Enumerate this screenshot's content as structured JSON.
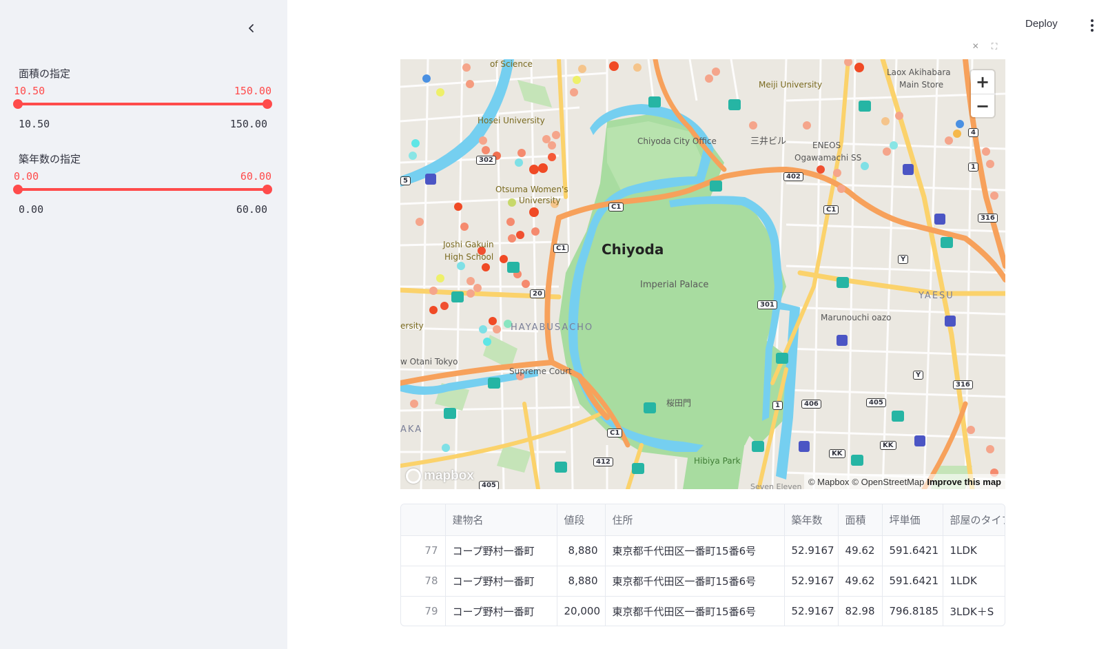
{
  "sidebar": {
    "sliders": [
      {
        "label": "面積の指定",
        "lo": "10.50",
        "hi": "150.00",
        "min": "10.50",
        "max": "150.00"
      },
      {
        "label": "築年数の指定",
        "lo": "0.00",
        "hi": "60.00",
        "min": "0.00",
        "max": "60.00"
      }
    ]
  },
  "header": {
    "deploy_label": "Deploy"
  },
  "map": {
    "labels": {
      "chiyoda": "Chiyoda",
      "imperial_palace": "Imperial Palace",
      "hosei": "Hosei University",
      "otsuma": "Otsuma Women's University",
      "otsuma_1": "Otsuma Women's",
      "otsuma_2": "University",
      "joshi_1": "Joshi Gakuin",
      "joshi_2": "High School",
      "meiji": "Meiji University",
      "laox_1": "Laox Akihabara",
      "laox_2": "Main Store",
      "chiyoda_office": "Chiyoda City Office",
      "mitsui": "三井ビル",
      "eneos_1": "ENEOS",
      "eneos_2": "Ogawamachi SS",
      "hayabusacho": "HAYABUSACHO",
      "supreme": "Supreme Court",
      "sakuradamon": "桜田門",
      "hibiya": "Hibiya Park",
      "marunouchi": "Marunouchi oazo",
      "yaesu": "YAESU",
      "otani": "w Otani Tokyo",
      "of_science": "of Science",
      "ersity": "ersity",
      "aka": "AKA",
      "seven_eleven": "Seven Eleven"
    },
    "routes": [
      "C1",
      "C1",
      "C1",
      "C1",
      "302",
      "402",
      "20",
      "301",
      "316",
      "316",
      "412",
      "406",
      "405",
      "4",
      "1",
      "1",
      "Y",
      "Y",
      "KK",
      "KK",
      "405",
      "5"
    ],
    "zoom_in": "+",
    "zoom_out": "−",
    "logo_text": "mapbox",
    "attribution": {
      "mapbox": "© Mapbox",
      "osm": "© OpenStreetMap",
      "improve": "Improve this map"
    }
  },
  "table": {
    "columns": [
      "",
      "建物名",
      "値段",
      "住所",
      "築年数",
      "面積",
      "坪単価",
      "部屋のタイプ"
    ],
    "rows": [
      [
        "77",
        "コープ野村一番町",
        "8,880",
        "東京都千代田区一番町15番6号",
        "52.9167",
        "49.62",
        "591.6421",
        "1LDK"
      ],
      [
        "78",
        "コープ野村一番町",
        "8,880",
        "東京都千代田区一番町15番6号",
        "52.9167",
        "49.62",
        "591.6421",
        "1LDK"
      ],
      [
        "79",
        "コープ野村一番町",
        "20,000",
        "東京都千代田区一番町15番6号",
        "52.9167",
        "82.98",
        "796.8185",
        "3LDK＋S"
      ]
    ]
  }
}
